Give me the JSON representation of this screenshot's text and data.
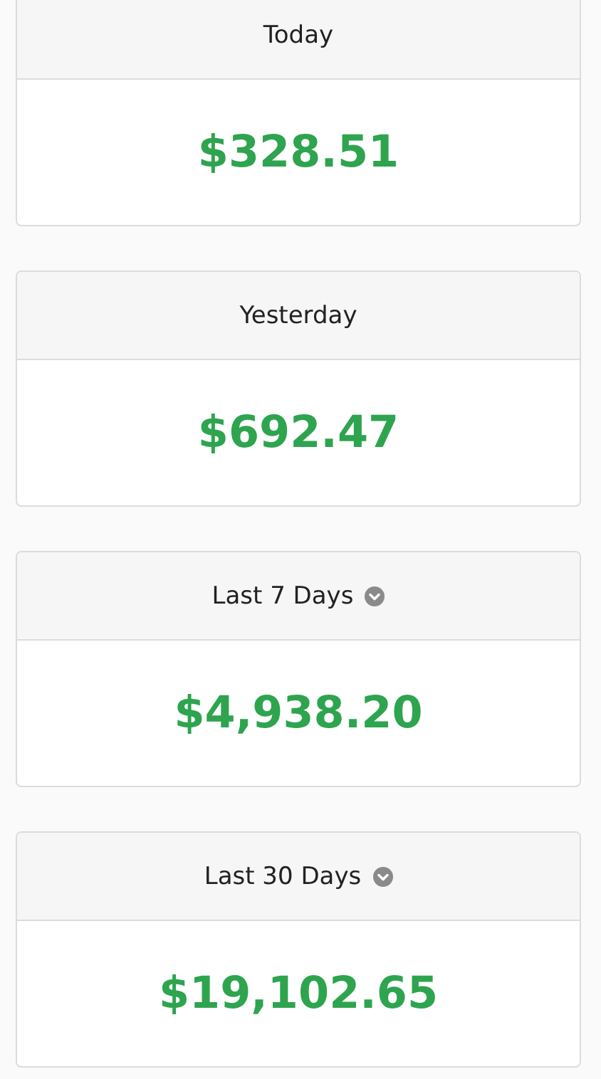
{
  "cards": [
    {
      "title": "Today",
      "has_dropdown": false,
      "amount": "$328.51"
    },
    {
      "title": "Yesterday",
      "has_dropdown": false,
      "amount": "$692.47"
    },
    {
      "title": "Last 7 Days",
      "has_dropdown": true,
      "amount": "$4,938.20"
    },
    {
      "title": "Last 30 Days",
      "has_dropdown": true,
      "amount": "$19,102.65"
    }
  ]
}
